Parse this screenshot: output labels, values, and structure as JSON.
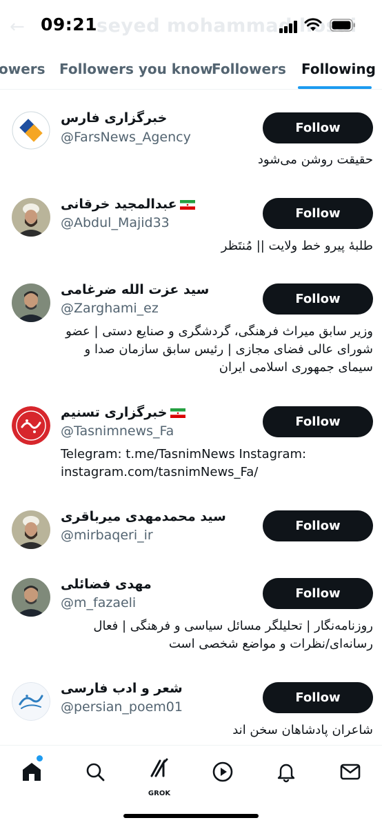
{
  "status_bar": {
    "time": "09:21",
    "ghost_title": "seyed mohammad hosai",
    "ghost_back": "←"
  },
  "tabs": [
    {
      "label": "owers"
    },
    {
      "label": "Followers you know"
    },
    {
      "label": "Followers"
    },
    {
      "label": "Following",
      "active": true
    }
  ],
  "accounts": [
    {
      "name": "خبرگزاری فارس",
      "handle": "@FarsNews_Agency",
      "bio": "حقیقت روشن می‌شود",
      "follow_label": "Follow",
      "flag": false,
      "avatar_icon": "fars-logo-icon"
    },
    {
      "name": "عبدالمجید خرقانی",
      "handle": "@Abdul_Majid33",
      "bio": "طلبهٔ پیرو خط ولایت || مُنتَظر",
      "follow_label": "Follow",
      "flag": true,
      "avatar_icon": "cleric-photo"
    },
    {
      "name": "سید عزت الله ضرغامی",
      "handle": "@Zarghami_ez",
      "bio": "وزیر سابق میراث فرهنگی، گردشگری و صنایع دستی | عضو شورای عالی فضای مجازی | رئیس سابق سازمان صدا و سیمای جمهوری اسلامی ایران",
      "follow_label": "Follow",
      "flag": false,
      "avatar_icon": "man-photo"
    },
    {
      "name": "خبرگزاری تسنیم",
      "handle": "@Tasnimnews_Fa",
      "bio": "Telegram: t.me/TasnimNews Instagram: instagram.com/tasnimNews_Fa/",
      "follow_label": "Follow",
      "flag": true,
      "avatar_icon": "tasnim-logo-icon"
    },
    {
      "name": "سید محمدمهدی میرباقری",
      "handle": "@mirbaqeri_ir",
      "bio": "",
      "follow_label": "Follow",
      "flag": false,
      "avatar_icon": "cleric-photo"
    },
    {
      "name": "مهدی فضائلی",
      "handle": "@m_fazaeli",
      "bio": "روزنامه‌نگار | تحلیلگر مسائل سیاسی و فرهنگی | فعال رسانه‌ای/نظرات و مواضع شخصی است",
      "follow_label": "Follow",
      "flag": false,
      "avatar_icon": "man-photo"
    },
    {
      "name": "شعر و ادب فارسی",
      "handle": "@persian_poem01",
      "bio": "شاعران پادشاهان سخن اند",
      "follow_label": "Follow",
      "flag": false,
      "avatar_icon": "calligraphy-logo-icon"
    }
  ],
  "bottom_nav": {
    "items": [
      "home-icon",
      "search-icon",
      "grok-icon",
      "play-icon",
      "bell-icon",
      "mail-icon"
    ],
    "grok_label": "GROK"
  },
  "colors": {
    "accent": "#1d9bf0",
    "button": "#0f1419",
    "secondary_text": "#536471"
  }
}
